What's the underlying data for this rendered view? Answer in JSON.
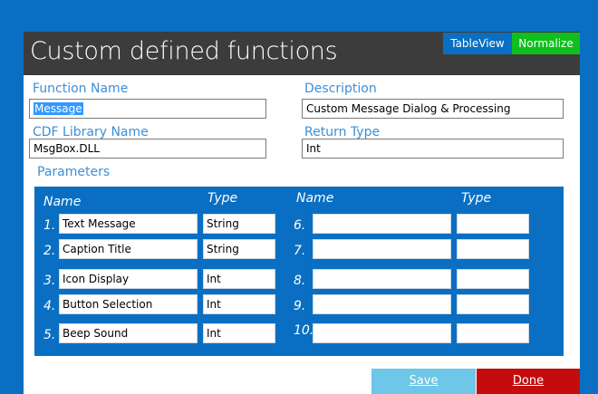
{
  "window": {
    "title": "Custom defined functions",
    "tableview_label": "TableView",
    "normalize_label": "Normalize"
  },
  "form": {
    "function_name_label": "Function Name",
    "function_name_value": "Message",
    "description_label": "Description",
    "description_value": "Custom Message Dialog & Processing",
    "cdf_library_label": "CDF Library Name",
    "cdf_library_value": "MsgBox.DLL",
    "return_type_label": "Return Type",
    "return_type_value": "Int",
    "parameters_label": "Parameters"
  },
  "parameters": {
    "name_header": "Name",
    "type_header": "Type",
    "left": [
      {
        "num": "1.",
        "name": "Text Message",
        "type": "String"
      },
      {
        "num": "2.",
        "name": "Caption Title",
        "type": "String"
      },
      {
        "num": "3.",
        "name": "Icon Display",
        "type": "Int"
      },
      {
        "num": "4.",
        "name": "Button Selection",
        "type": "Int"
      },
      {
        "num": "5.",
        "name": "Beep Sound",
        "type": "Int"
      }
    ],
    "right": [
      {
        "num": "6.",
        "name": "",
        "type": ""
      },
      {
        "num": "7.",
        "name": "",
        "type": ""
      },
      {
        "num": "8.",
        "name": "",
        "type": ""
      },
      {
        "num": "9.",
        "name": "",
        "type": ""
      },
      {
        "num": "10.",
        "name": "",
        "type": ""
      }
    ]
  },
  "buttons": {
    "save_label": "Save",
    "done_label": "Done"
  },
  "colors": {
    "background": "#0a6fc2",
    "titlebar": "#3c3c3c",
    "label_blue": "#3d8fd6",
    "normalize_green": "#0fbf1e",
    "save_disabled": "#6ec6e8",
    "done_red": "#c40c0c"
  }
}
